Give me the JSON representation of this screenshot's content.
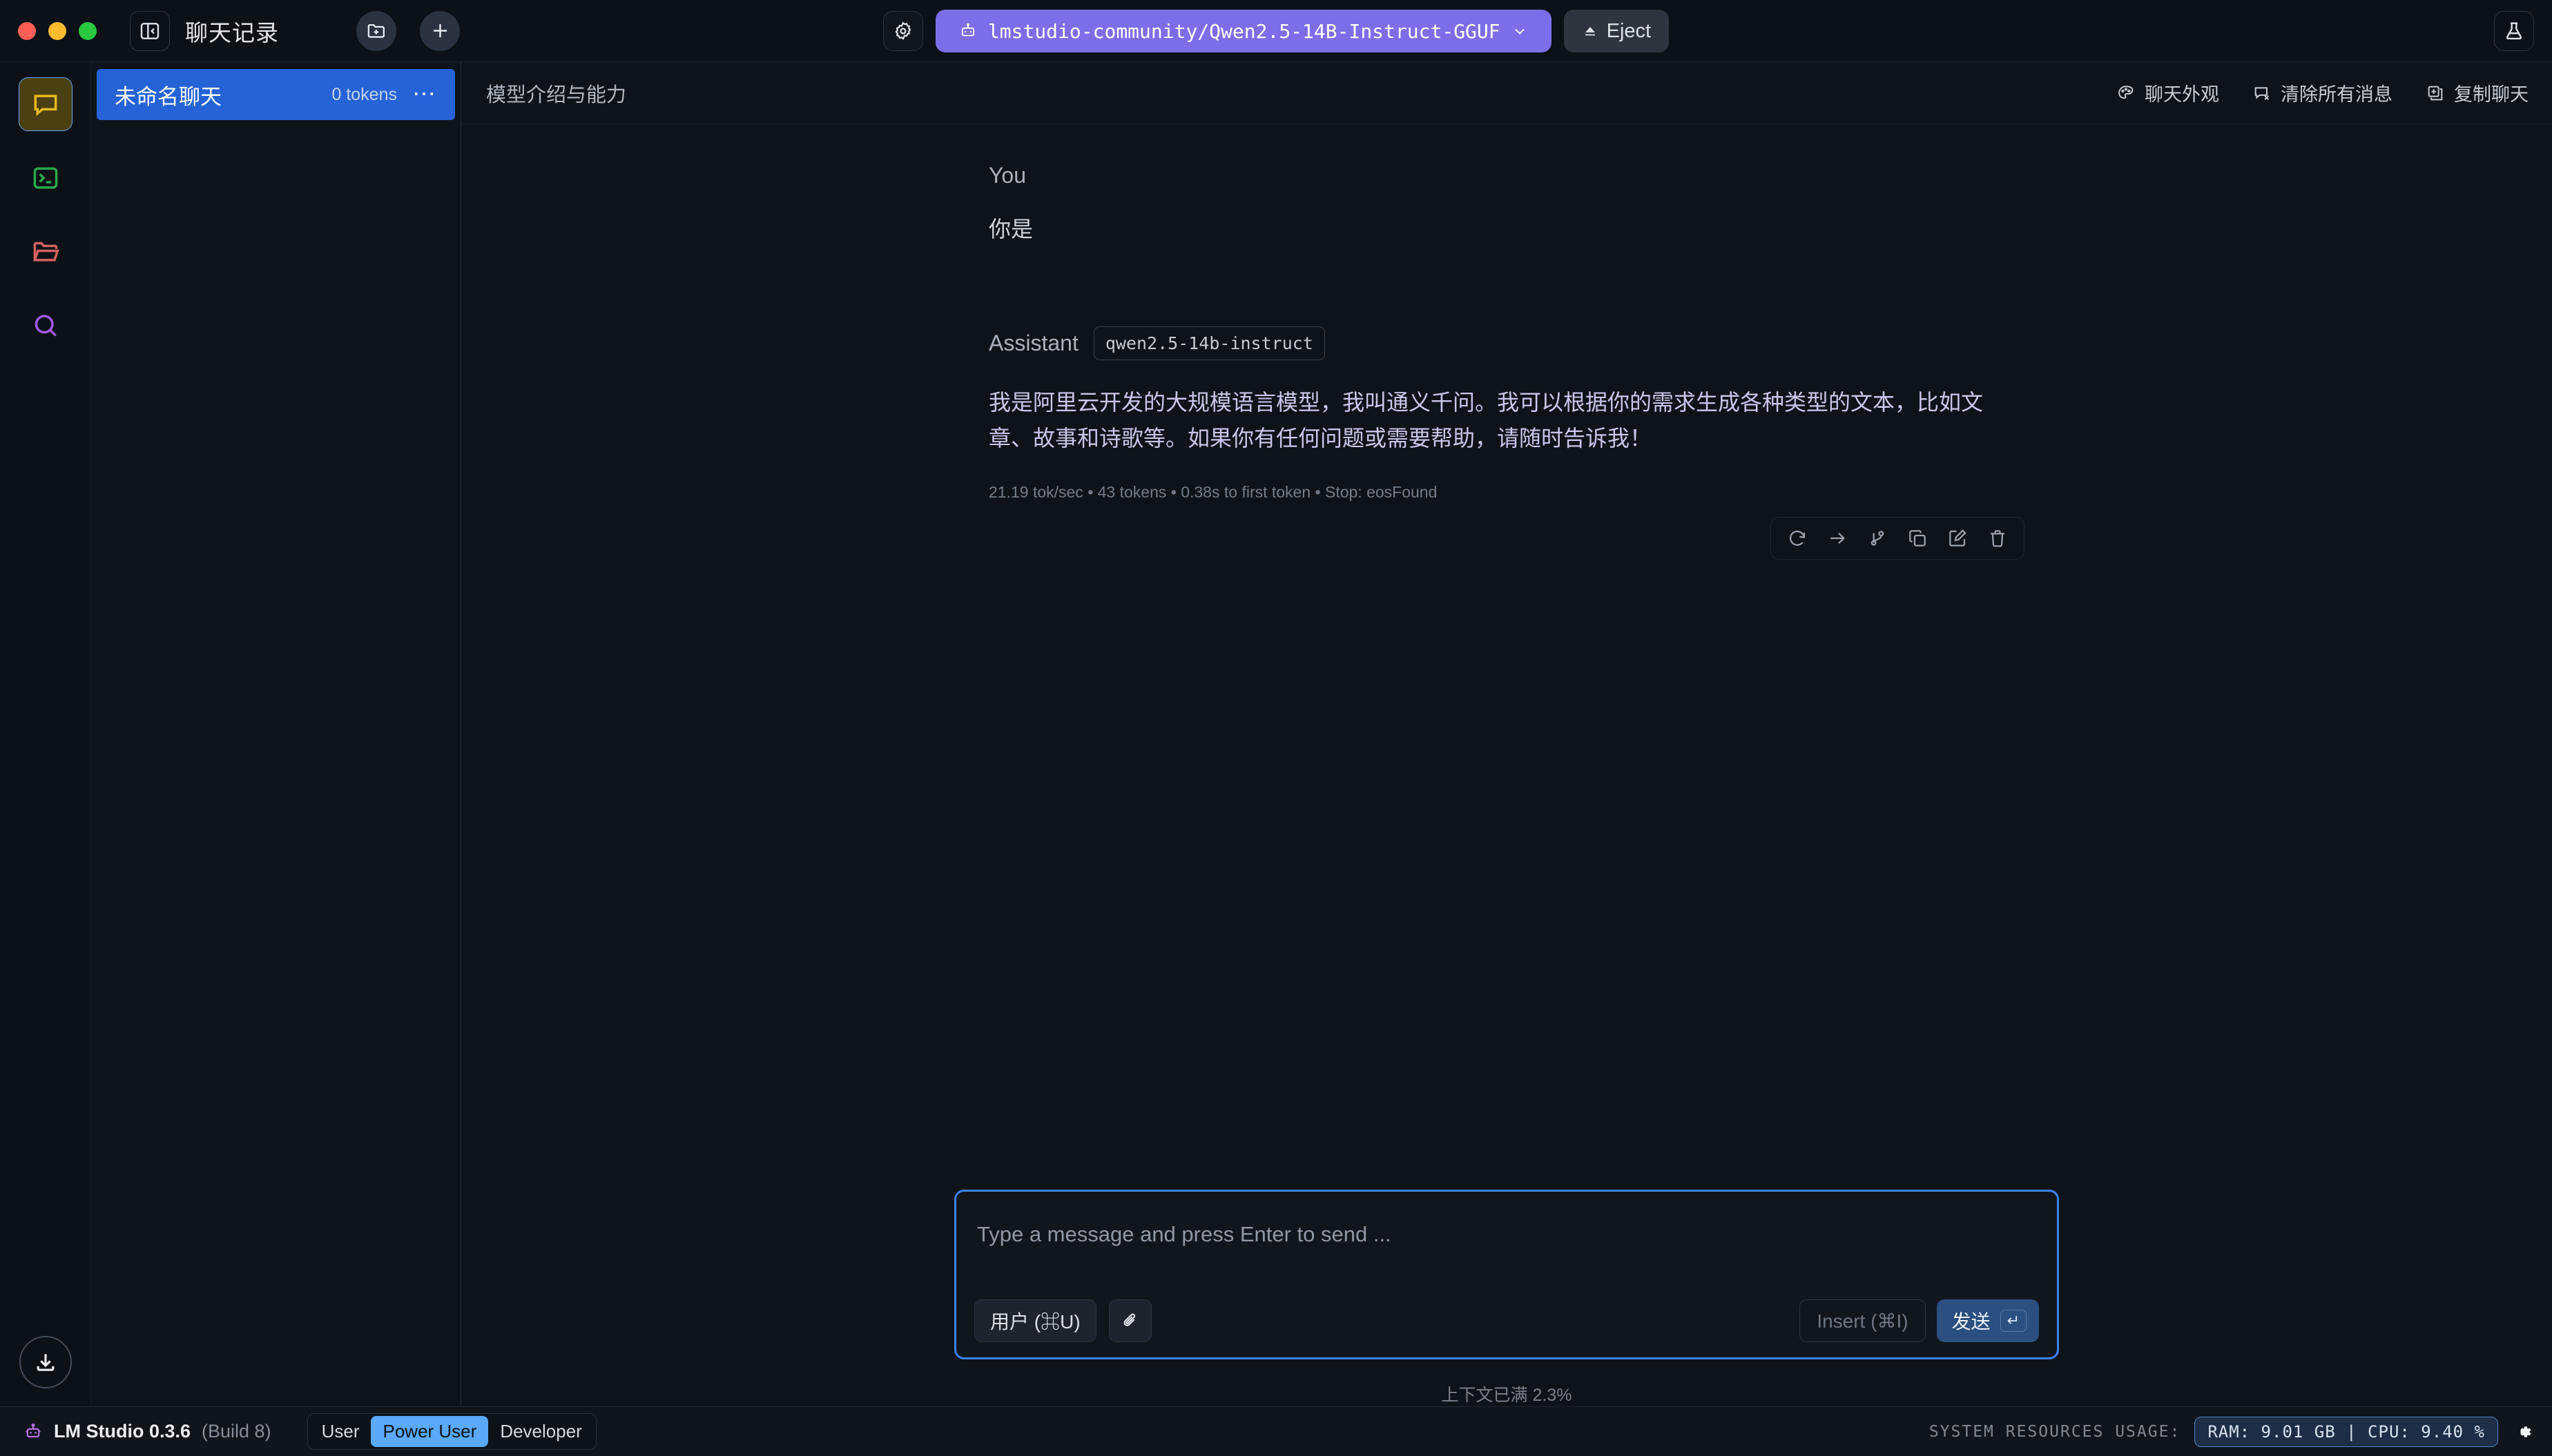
{
  "window": {
    "sidebar_title": "聊天记录",
    "traffic_lights": [
      "close",
      "minimize",
      "zoom"
    ]
  },
  "toolbar": {
    "settings_icon": "gear-icon",
    "model_name": "lmstudio-community/Qwen2.5-14B-Instruct-GGUF",
    "model_icon": "robot-icon",
    "model_chevron": "chevron-down-icon",
    "eject_label": "Eject",
    "eject_icon": "eject-icon",
    "flask_icon": "flask-icon",
    "panel_toggle_icon": "panel-collapse-icon",
    "new_folder_icon": "folder-plus-icon",
    "new_chat_icon": "plus-icon",
    "accent_purple": "#7c6ee8"
  },
  "rail": {
    "items": [
      {
        "name": "chat",
        "icon": "chat-bubble-icon",
        "color": "#e8b923",
        "active": true
      },
      {
        "name": "developer",
        "icon": "terminal-icon",
        "color": "#2aa84a",
        "active": false
      },
      {
        "name": "my-models",
        "icon": "folder-icon",
        "color": "#d4625f",
        "active": false
      },
      {
        "name": "discover",
        "icon": "search-icon",
        "color": "#a259e6",
        "active": false
      }
    ],
    "download_icon": "download-icon"
  },
  "chat_list": {
    "rows": [
      {
        "name": "未命名聊天",
        "tokens": "0 tokens",
        "menu": "⋯",
        "selected": true
      }
    ],
    "selected_color": "#2563d6"
  },
  "main_header": {
    "title": "模型介绍与能力",
    "actions": [
      {
        "label": "聊天外观",
        "icon": "palette-icon"
      },
      {
        "label": "清除所有消息",
        "icon": "message-x-icon"
      },
      {
        "label": "复制聊天",
        "icon": "copy-chat-icon"
      }
    ]
  },
  "conversation": {
    "user": {
      "role": "You",
      "text": "你是"
    },
    "assistant": {
      "role": "Assistant",
      "model_badge": "qwen2.5-14b-instruct",
      "text": "我是阿里云开发的大规模语言模型，我叫通义千问。我可以根据你的需求生成各种类型的文本，比如文章、故事和诗歌等。如果你有任何问题或需要帮助，请随时告诉我！",
      "text_color": "#cbc6ea",
      "stats": "21.19 tok/sec • 43 tokens • 0.38s to first token • Stop: eosFound",
      "actions": [
        {
          "name": "regenerate",
          "icon": "regenerate-icon"
        },
        {
          "name": "continue",
          "icon": "arrow-right-icon"
        },
        {
          "name": "branch",
          "icon": "branch-icon"
        },
        {
          "name": "copy",
          "icon": "copy-icon"
        },
        {
          "name": "edit",
          "icon": "edit-icon"
        },
        {
          "name": "delete",
          "icon": "trash-icon"
        }
      ]
    }
  },
  "composer": {
    "placeholder": "Type a message and press Enter to send ...",
    "value": "",
    "role_chip": "用户 (⌘U)",
    "attach_icon": "paperclip-icon",
    "insert_label": "Insert (⌘I)",
    "send_label": "发送",
    "send_key": "↵",
    "focus_color": "#3b82f6",
    "context_status": "上下文已满 2.3%"
  },
  "statusbar": {
    "app_icon": "lmstudio-robot-icon",
    "app_name": "LM Studio 0.3.6",
    "build": "(Build 8)",
    "modes": [
      {
        "label": "User",
        "active": false
      },
      {
        "label": "Power User",
        "active": true
      },
      {
        "label": "Developer",
        "active": false
      }
    ],
    "resources_label": "SYSTEM RESOURCES USAGE:",
    "resources_value": "RAM: 9.01 GB  |  CPU: 9.40 %",
    "settings_icon": "gear-icon"
  }
}
